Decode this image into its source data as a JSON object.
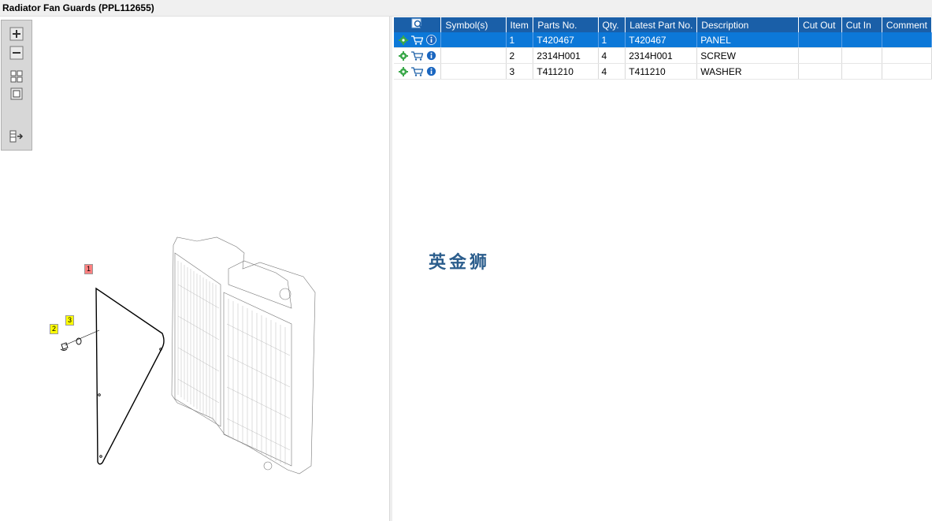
{
  "window": {
    "title": "Radiator Fan Guards (PPL112655)"
  },
  "toolbar": {
    "buttons": [
      {
        "icon": "zoom-in-icon"
      },
      {
        "icon": "zoom-out-icon"
      },
      {
        "icon": "fit-all-icon"
      },
      {
        "icon": "fit-window-icon"
      },
      {
        "icon": "layout-icon"
      }
    ]
  },
  "drawing": {
    "callouts": [
      {
        "label": "1",
        "color": "#ff8080"
      },
      {
        "label": "2",
        "color": "#ffff00"
      },
      {
        "label": "3",
        "color": "#ffff00"
      }
    ]
  },
  "table": {
    "columns": [
      "Symbol(s)",
      "Item",
      "Parts No.",
      "Qty.",
      "Latest Part No.",
      "Description",
      "Cut Out",
      "Cut In",
      "Comment"
    ],
    "rows": [
      {
        "symbols": "",
        "item": "1",
        "part_no": "T420467",
        "qty": "1",
        "latest_part_no": "T420467",
        "description": "PANEL",
        "cut_out": "",
        "cut_in": "",
        "comment": "",
        "selected": true
      },
      {
        "symbols": "",
        "item": "2",
        "part_no": "2314H001",
        "qty": "4",
        "latest_part_no": "2314H001",
        "description": "SCREW",
        "cut_out": "",
        "cut_in": "",
        "comment": "",
        "selected": false
      },
      {
        "symbols": "",
        "item": "3",
        "part_no": "T411210",
        "qty": "4",
        "latest_part_no": "T411210",
        "description": "WASHER",
        "cut_out": "",
        "cut_in": "",
        "comment": "",
        "selected": false
      }
    ]
  },
  "watermark": "英金狮",
  "colors": {
    "header": "#1a5fa8",
    "selected_row": "#0c78d8",
    "gear": "#3aa84a",
    "info": "#1a66c0"
  }
}
